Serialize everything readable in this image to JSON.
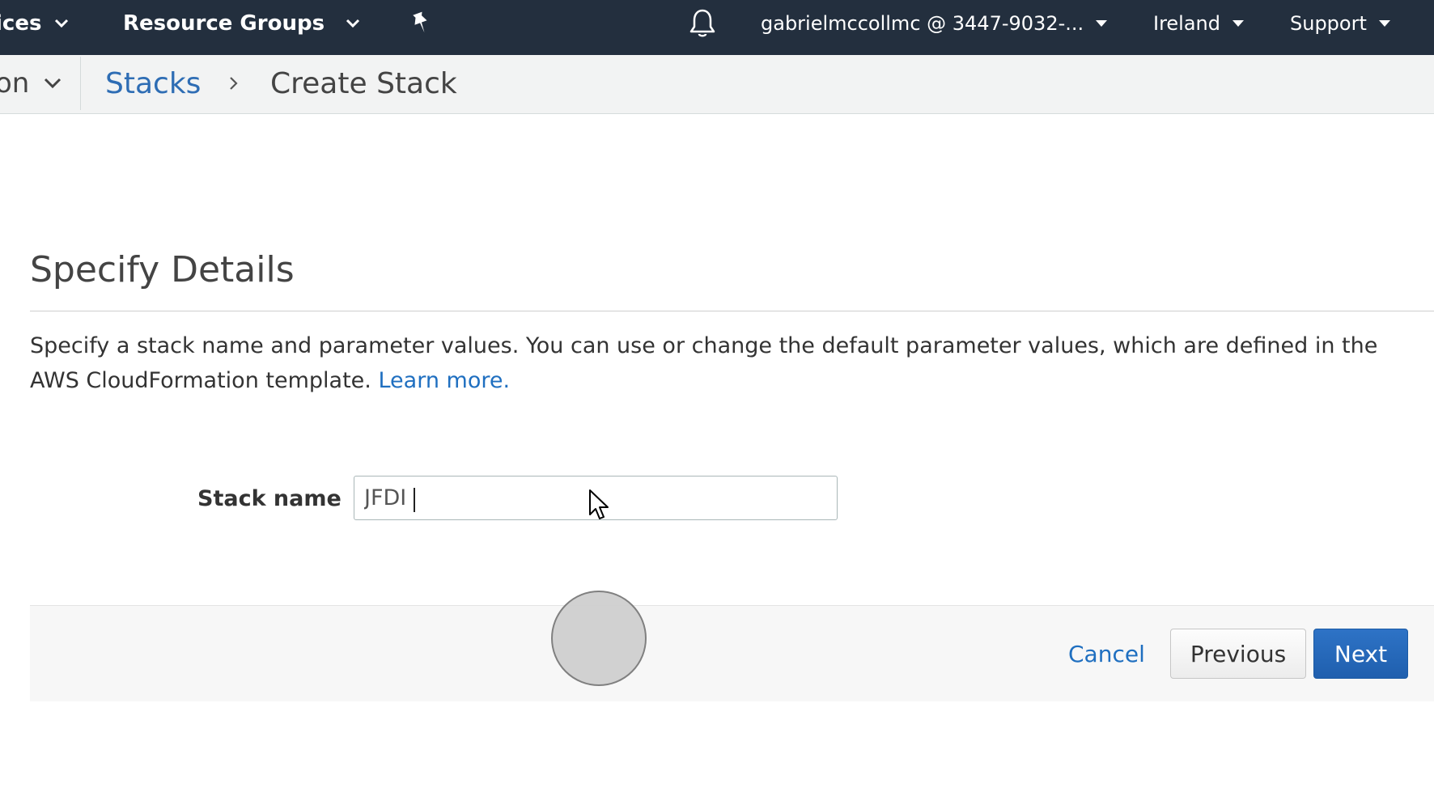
{
  "topnav": {
    "services_label": "ices",
    "resource_groups_label": "Resource Groups",
    "account_label": "gabrielmccollmc @ 3447-9032-...",
    "region_label": "Ireland",
    "support_label": "Support",
    "background_color": "#232f3e"
  },
  "breadcrumb": {
    "previous_label": "on",
    "stacks_label": "Stacks",
    "current_label": "Create Stack"
  },
  "page": {
    "heading": "Specify Details",
    "description": "Specify a stack name and parameter values. You can use or change the default parameter values, which are defined in the AWS CloudFormation template.",
    "learn_more": "Learn more."
  },
  "form": {
    "stack_name_label": "Stack name",
    "stack_name_value": "JFDI"
  },
  "footer": {
    "cancel_label": "Cancel",
    "previous_label": "Previous",
    "next_label": "Next",
    "primary_color": "#1f5fae",
    "link_color": "#1f6fc0"
  }
}
